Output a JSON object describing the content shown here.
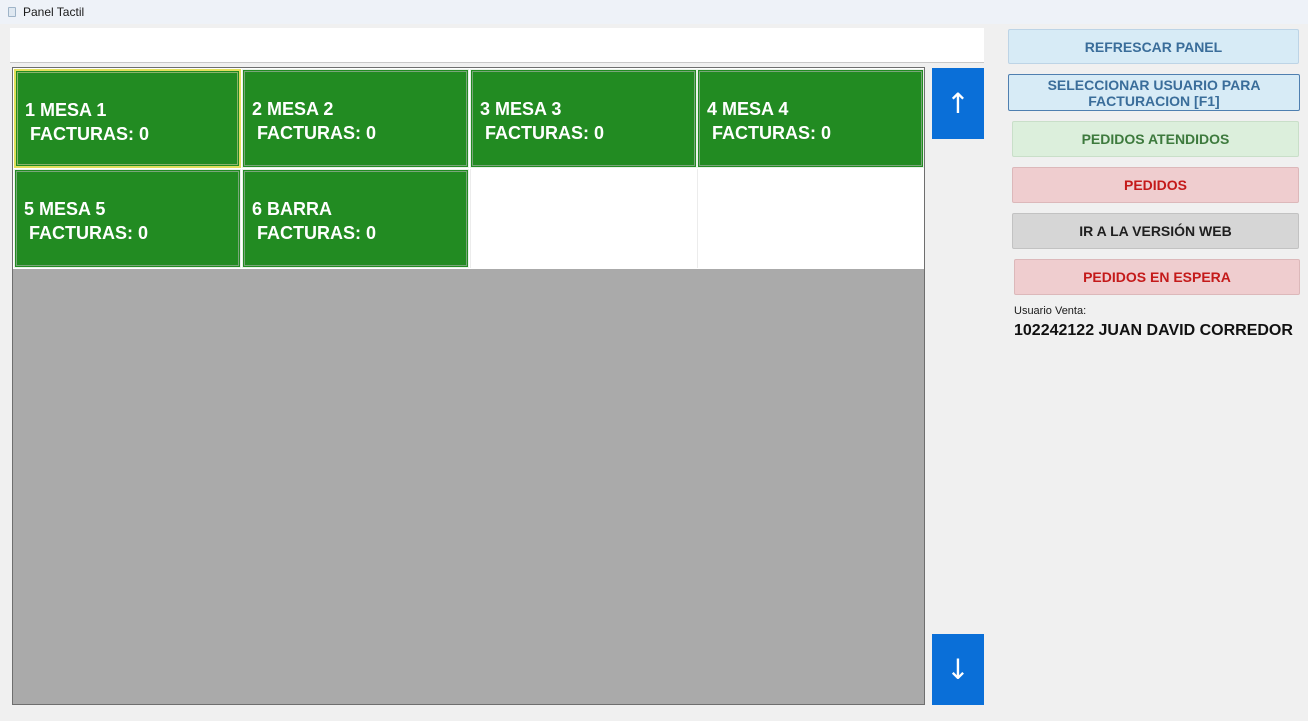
{
  "window": {
    "title": "Panel Tactil",
    "icon": "app-icon"
  },
  "tables": [
    {
      "label": "1 MESA 1\n FACTURAS: 0",
      "selected": true
    },
    {
      "label": "2 MESA 2\n FACTURAS: 0",
      "selected": false
    },
    {
      "label": "3 MESA 3\n FACTURAS: 0",
      "selected": false
    },
    {
      "label": "4 MESA 4\n FACTURAS: 0",
      "selected": false
    },
    {
      "label": "5 MESA 5\n FACTURAS: 0",
      "selected": false
    },
    {
      "label": "6 BARRA\n FACTURAS: 0",
      "selected": false
    }
  ],
  "scroll": {
    "up_label": "↑",
    "down_label": "↓"
  },
  "actions": {
    "refresh": "REFRESCAR PANEL",
    "select_user": "SELECCIONAR USUARIO PARA FACTURACION [F1]",
    "attended_orders": "PEDIDOS ATENDIDOS",
    "orders": "PEDIDOS",
    "web_version": "IR A LA VERSIÓN WEB",
    "waiting_orders": "PEDIDOS EN ESPERA"
  },
  "user": {
    "label": "Usuario Venta:",
    "value": "102242122 JUAN DAVID CORREDOR"
  },
  "colors": {
    "table_fill": "#228b22",
    "scroll_button": "#0a6fd8",
    "panel_background": "#aaaaaa"
  }
}
